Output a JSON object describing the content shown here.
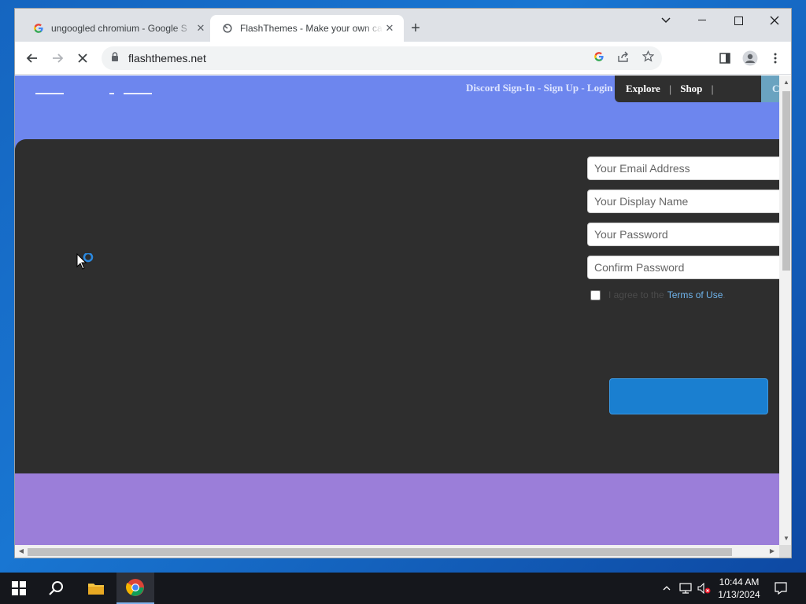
{
  "browser": {
    "tabs": [
      {
        "title": "ungoogled chromium - Google S",
        "favicon": "google-icon",
        "active": false
      },
      {
        "title": "FlashThemes - Make your own ca",
        "favicon": "flashthemes-icon",
        "active": true
      }
    ],
    "url": "flashthemes.net",
    "page_loading": true
  },
  "page": {
    "auth_links": {
      "discord": "Discord Sign-In",
      "sep1": " - ",
      "signup": "Sign Up",
      "sep2": " - ",
      "login": "Login"
    },
    "nav": {
      "explore": "Explore",
      "shop": "Shop",
      "tail": "C"
    },
    "form": {
      "email_placeholder": "Your Email Address",
      "display_name_placeholder": "Your Display Name",
      "password_placeholder": "Your Password",
      "confirm_placeholder": "Confirm Password",
      "agree_text": "I agree to the",
      "terms_link": "Terms of Use",
      "terms_end": "."
    },
    "colors": {
      "header_bg": "#6d86ee",
      "hero_bg": "#2e2e2e",
      "footer_bg": "#9b7ed9",
      "button_bg": "#1a7fd0"
    }
  },
  "taskbar": {
    "time": "10:44 AM",
    "date": "1/13/2024"
  }
}
